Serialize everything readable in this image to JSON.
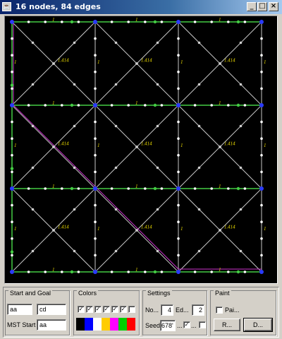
{
  "window": {
    "title": "16 nodes, 84 edges"
  },
  "graph": {
    "colors": {
      "edge": "#c8c8c8",
      "mst_edge": "#44cc44",
      "path": "#cc33cc",
      "node": "#d0d0d0",
      "weight_label": "#e8d800",
      "node_label": "#2a3bff"
    },
    "grid_edge_weight": "1",
    "diag_edge_weight": "1.414"
  },
  "start_goal": {
    "legend": "Start and Goal",
    "start_value": "aa",
    "goal_value": "cd",
    "mst_label": "MST Start",
    "mst_value": "aa"
  },
  "colors_group": {
    "legend": "Colors",
    "checkboxes": [
      "✓",
      "✓",
      "✓",
      "✓",
      "✓",
      "✓",
      ""
    ],
    "swatches": [
      "#000000",
      "#0000ff",
      "#ffffff",
      "#ffcc00",
      "#ff00ff",
      "#00cc00",
      "#ff0000"
    ]
  },
  "settings": {
    "legend": "Settings",
    "nodes_label": "No...",
    "nodes_value": "4",
    "edges_label": "Ed...",
    "edges_value": "2",
    "seed_label": "Seed",
    "seed_value": "678'",
    "more_label": "...",
    "check1": "✓",
    "check2": ""
  },
  "paint": {
    "legend": "Paint",
    "paint_check_label": "Pai...",
    "r_button": "R...",
    "d_button": "D..."
  }
}
